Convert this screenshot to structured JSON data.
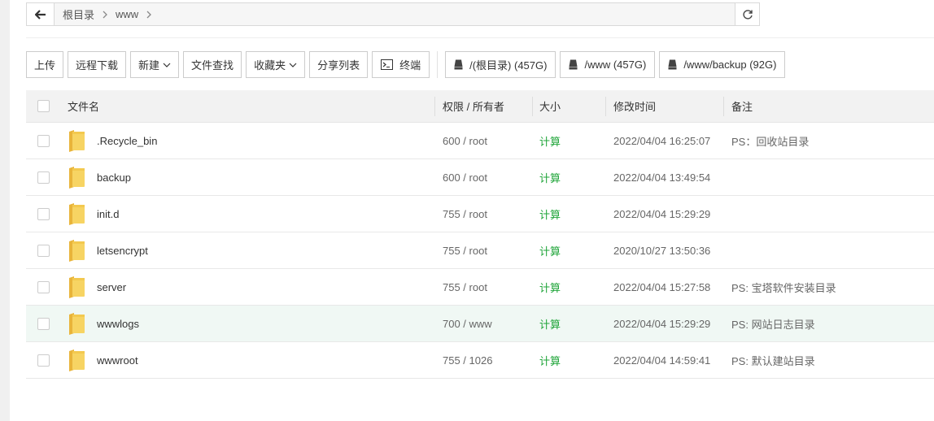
{
  "address_bar": {
    "crumbs": [
      "根目录",
      "www"
    ]
  },
  "toolbar": {
    "upload": "上传",
    "remote_download": "远程下载",
    "new": "新建",
    "file_search": "文件查找",
    "favorites": "收藏夹",
    "share_list": "分享列表",
    "terminal": "终端",
    "disks": [
      "/(根目录) (457G)",
      "/www (457G)",
      "/www/backup (92G)"
    ]
  },
  "table": {
    "headers": {
      "name": "文件名",
      "perm": "权限 / 所有者",
      "size": "大小",
      "mtime": "修改时间",
      "note": "备注"
    },
    "rows": [
      {
        "name": ".Recycle_bin",
        "perm": "600 / root",
        "size": "计算",
        "mtime": "2022/04/04 16:25:07",
        "note": "PS：回收站目录"
      },
      {
        "name": "backup",
        "perm": "600 / root",
        "size": "计算",
        "mtime": "2022/04/04 13:49:54",
        "note": ""
      },
      {
        "name": "init.d",
        "perm": "755 / root",
        "size": "计算",
        "mtime": "2022/04/04 15:29:29",
        "note": ""
      },
      {
        "name": "letsencrypt",
        "perm": "755 / root",
        "size": "计算",
        "mtime": "2020/10/27 13:50:36",
        "note": ""
      },
      {
        "name": "server",
        "perm": "755 / root",
        "size": "计算",
        "mtime": "2022/04/04 15:27:58",
        "note": "PS: 宝塔软件安装目录"
      },
      {
        "name": "wwwlogs",
        "perm": "700 / www",
        "size": "计算",
        "mtime": "2022/04/04 15:29:29",
        "note": "PS: 网站日志目录"
      },
      {
        "name": "wwwroot",
        "perm": "755 / 1026",
        "size": "计算",
        "mtime": "2022/04/04 14:59:41",
        "note": "PS: 默认建站目录"
      }
    ]
  },
  "colors": {
    "accent_green": "#20a53a",
    "folder_yellow": "#f5c842",
    "highlight_row": "#f0f8f4"
  }
}
